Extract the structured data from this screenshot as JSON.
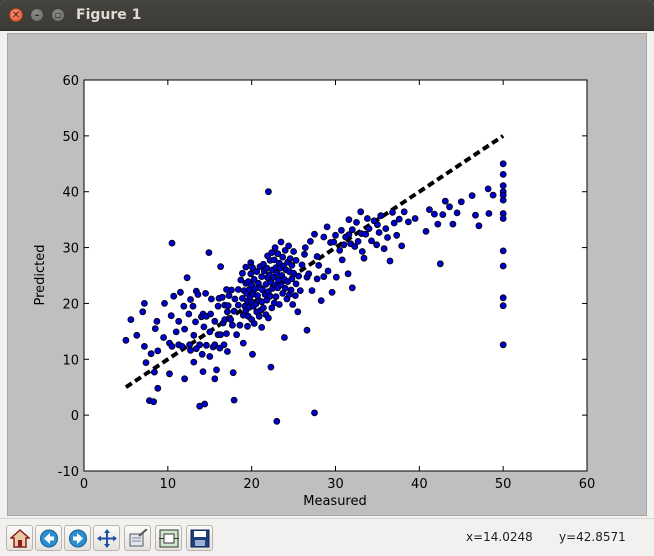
{
  "window": {
    "title": "Figure 1",
    "close_glyph": "✕",
    "minimize_glyph": "–",
    "maximize_glyph": "▫"
  },
  "toolbar": {
    "buttons": [
      {
        "name": "home-button",
        "icon": "home-icon"
      },
      {
        "name": "back-button",
        "icon": "back-arrow-icon"
      },
      {
        "name": "forward-button",
        "icon": "forward-arrow-icon"
      },
      {
        "name": "pan-button",
        "icon": "pan-icon"
      },
      {
        "name": "zoom-button",
        "icon": "zoom-rect-icon"
      },
      {
        "name": "subplots-button",
        "icon": "subplots-icon"
      },
      {
        "name": "save-button",
        "icon": "save-icon"
      }
    ],
    "coord_x": "x=14.0248",
    "coord_y": "y=42.8571"
  },
  "chart_data": {
    "type": "scatter",
    "xlabel": "Measured",
    "ylabel": "Predicted",
    "xlim": [
      0,
      60
    ],
    "ylim": [
      -10,
      60
    ],
    "xticks": [
      0,
      10,
      20,
      30,
      40,
      50,
      60
    ],
    "yticks": [
      -10,
      0,
      10,
      20,
      30,
      40,
      50,
      60
    ],
    "grid": false,
    "point_color": "#0000cc",
    "reference_line": {
      "x": [
        5,
        50
      ],
      "y": [
        5,
        50
      ],
      "style": "dashed",
      "color": "#000000"
    },
    "points": [
      [
        5,
        13.4
      ],
      [
        5.6,
        17.1
      ],
      [
        6.3,
        14.3
      ],
      [
        7,
        18.5
      ],
      [
        7.2,
        20
      ],
      [
        7.2,
        12.3
      ],
      [
        7.4,
        9.4
      ],
      [
        8,
        11
      ],
      [
        7.8,
        2.6
      ],
      [
        8.3,
        2.4
      ],
      [
        8.8,
        11.5
      ],
      [
        8.5,
        15.5
      ],
      [
        8.4,
        7.7
      ],
      [
        8.8,
        4.8
      ],
      [
        8.7,
        16.8
      ],
      [
        9.5,
        13.9
      ],
      [
        9.6,
        20
      ],
      [
        10.2,
        12.9
      ],
      [
        10.4,
        17.8
      ],
      [
        10.2,
        7.4
      ],
      [
        10.5,
        30.8
      ],
      [
        10.5,
        12.3
      ],
      [
        10.7,
        21.3
      ],
      [
        11,
        14.9
      ],
      [
        11.3,
        12.6
      ],
      [
        11.3,
        16.8
      ],
      [
        11.5,
        22
      ],
      [
        11.7,
        12.3
      ],
      [
        11.9,
        19.5
      ],
      [
        12,
        6.5
      ],
      [
        12,
        15.4
      ],
      [
        12.3,
        24.6
      ],
      [
        12.5,
        18.1
      ],
      [
        12.6,
        12.6
      ],
      [
        12.7,
        20.7
      ],
      [
        12.7,
        11.6
      ],
      [
        13,
        19.5
      ],
      [
        13.1,
        14.3
      ],
      [
        13.3,
        16.7
      ],
      [
        13.4,
        22.2
      ],
      [
        13.1,
        9.5
      ],
      [
        13.4,
        11.9
      ],
      [
        13.6,
        21.6
      ],
      [
        13.8,
        12.6
      ],
      [
        13.8,
        1.6
      ],
      [
        14,
        17.6
      ],
      [
        14.2,
        7.8
      ],
      [
        14.2,
        18.1
      ],
      [
        14.1,
        10.9
      ],
      [
        14.3,
        15.8
      ],
      [
        14.4,
        2
      ],
      [
        14.5,
        21.8
      ],
      [
        14.6,
        12.5
      ],
      [
        14.6,
        17.7
      ],
      [
        14.9,
        29.1
      ],
      [
        15,
        10.5
      ],
      [
        15,
        14.9
      ],
      [
        15.1,
        18.1
      ],
      [
        15.2,
        20.8
      ],
      [
        15.4,
        12.2
      ],
      [
        15.6,
        16.8
      ],
      [
        15.6,
        6.5
      ],
      [
        15.6,
        12.6
      ],
      [
        15.8,
        8.1
      ],
      [
        16,
        19.5
      ],
      [
        16,
        14.4
      ],
      [
        16.1,
        20.9
      ],
      [
        16.2,
        12
      ],
      [
        16.3,
        14.4
      ],
      [
        16.3,
        26.6
      ],
      [
        16.5,
        21.1
      ],
      [
        16.6,
        16.5
      ],
      [
        16.7,
        12.6
      ],
      [
        16.8,
        19.7
      ],
      [
        16.8,
        17.1
      ],
      [
        17,
        14.6
      ],
      [
        17,
        22.5
      ],
      [
        17.1,
        18.5
      ],
      [
        17.1,
        11.4
      ],
      [
        17.2,
        19.6
      ],
      [
        17.3,
        17.3
      ],
      [
        17.3,
        21.4
      ],
      [
        17.5,
        17.1
      ],
      [
        17.6,
        22.4
      ],
      [
        17.7,
        16.1
      ],
      [
        17.8,
        7.6
      ],
      [
        17.9,
        18.6
      ],
      [
        17.9,
        2.7
      ],
      [
        18,
        20.8
      ],
      [
        18.2,
        14.4
      ],
      [
        18.4,
        22.5
      ],
      [
        18.4,
        19.7
      ],
      [
        18.6,
        16.1
      ],
      [
        18.7,
        24.2
      ],
      [
        18.9,
        25.4
      ],
      [
        18.9,
        20.9
      ],
      [
        19,
        12.9
      ],
      [
        19,
        17.9
      ],
      [
        19.1,
        22.3
      ],
      [
        19.2,
        19.5
      ],
      [
        19.3,
        18.7
      ],
      [
        19.3,
        26.5
      ],
      [
        19.3,
        23.6
      ],
      [
        19.4,
        21.8
      ],
      [
        19.5,
        15.9
      ],
      [
        19.5,
        20.4
      ],
      [
        19.6,
        17.7
      ],
      [
        19.6,
        23.9
      ],
      [
        19.7,
        19.3
      ],
      [
        19.7,
        22.5
      ],
      [
        19.8,
        21.1
      ],
      [
        19.9,
        25.3
      ],
      [
        19.9,
        27.3
      ],
      [
        20,
        20.2
      ],
      [
        20,
        17.1
      ],
      [
        20,
        23.3
      ],
      [
        20.1,
        10.9
      ],
      [
        20.1,
        26.4
      ],
      [
        20.2,
        19.5
      ],
      [
        20.2,
        21.7
      ],
      [
        20.3,
        24.3
      ],
      [
        20.3,
        16.4
      ],
      [
        20.4,
        22.6
      ],
      [
        20.5,
        19.9
      ],
      [
        20.6,
        18.5
      ],
      [
        20.6,
        25.7
      ],
      [
        20.7,
        21.4
      ],
      [
        20.8,
        23.6
      ],
      [
        20.9,
        17.7
      ],
      [
        20.9,
        20.5
      ],
      [
        21,
        22.8
      ],
      [
        21,
        26.6
      ],
      [
        21.1,
        18.8
      ],
      [
        21.2,
        24.8
      ],
      [
        21.2,
        20.3
      ],
      [
        21.2,
        15.7
      ],
      [
        21.3,
        22.4
      ],
      [
        21.4,
        27
      ],
      [
        21.4,
        19.2
      ],
      [
        21.5,
        25.8
      ],
      [
        21.6,
        21.6
      ],
      [
        21.7,
        23.4
      ],
      [
        21.7,
        18
      ],
      [
        21.8,
        26.3
      ],
      [
        21.8,
        20.6
      ],
      [
        21.9,
        28.5
      ],
      [
        21.9,
        24.6
      ],
      [
        22,
        40
      ],
      [
        22,
        22.1
      ],
      [
        22,
        17.4
      ],
      [
        22.1,
        25.1
      ],
      [
        22.2,
        27.7
      ],
      [
        22.2,
        21.3
      ],
      [
        22.3,
        8.6
      ],
      [
        22.3,
        23.8
      ],
      [
        22.4,
        19.2
      ],
      [
        22.4,
        29.1
      ],
      [
        22.5,
        26
      ],
      [
        22.5,
        22.7
      ],
      [
        22.6,
        24.7
      ],
      [
        22.7,
        20.1
      ],
      [
        22.7,
        27.8
      ],
      [
        22.8,
        23.3
      ],
      [
        22.8,
        30
      ],
      [
        22.9,
        21.2
      ],
      [
        22.9,
        26.4
      ],
      [
        23,
        25.4
      ],
      [
        23,
        -1.1
      ],
      [
        23.1,
        22.8
      ],
      [
        23.1,
        28.9
      ],
      [
        23.2,
        24.2
      ],
      [
        23.3,
        27.2
      ],
      [
        23.3,
        19.8
      ],
      [
        23.4,
        26.3
      ],
      [
        23.5,
        23.3
      ],
      [
        23.5,
        31
      ],
      [
        23.6,
        25
      ],
      [
        23.7,
        21.8
      ],
      [
        23.7,
        28.3
      ],
      [
        23.8,
        26.7
      ],
      [
        23.9,
        24.3
      ],
      [
        23.9,
        13.9
      ],
      [
        24,
        22.7
      ],
      [
        24,
        29.5
      ],
      [
        24.1,
        26
      ],
      [
        24.2,
        20.8
      ],
      [
        24.3,
        27.4
      ],
      [
        24.3,
        23.9
      ],
      [
        24.4,
        30.3
      ],
      [
        24.5,
        21.6
      ],
      [
        24.5,
        25.7
      ],
      [
        24.6,
        28
      ],
      [
        24.7,
        22.4
      ],
      [
        24.8,
        24.4
      ],
      [
        24.8,
        26.8
      ],
      [
        24.9,
        19.8
      ],
      [
        25,
        25.4
      ],
      [
        25,
        29.3
      ],
      [
        25.2,
        21.4
      ],
      [
        25.3,
        27.7
      ],
      [
        25.3,
        23.5
      ],
      [
        25.5,
        18.5
      ],
      [
        25.6,
        24.9
      ],
      [
        25.8,
        22.3
      ],
      [
        26,
        26.9
      ],
      [
        26.3,
        28.8
      ],
      [
        26.4,
        30
      ],
      [
        26.6,
        15.2
      ],
      [
        26.6,
        24.7
      ],
      [
        26.8,
        25.3
      ],
      [
        27,
        31.1
      ],
      [
        27.2,
        22.3
      ],
      [
        27.5,
        0.4
      ],
      [
        27.5,
        32.4
      ],
      [
        27.8,
        28.4
      ],
      [
        27.8,
        24.4
      ],
      [
        28,
        26.8
      ],
      [
        28.3,
        20.5
      ],
      [
        28.6,
        31.9
      ],
      [
        28.6,
        24.8
      ],
      [
        29,
        33.7
      ],
      [
        29.1,
        25.8
      ],
      [
        29.4,
        30.9
      ],
      [
        29.6,
        22
      ],
      [
        29.8,
        31
      ],
      [
        30,
        32.2
      ],
      [
        30.1,
        24.7
      ],
      [
        30.5,
        29.5
      ],
      [
        30.7,
        33.1
      ],
      [
        30.8,
        27.8
      ],
      [
        31,
        30.5
      ],
      [
        31.2,
        31.9
      ],
      [
        31.5,
        25.3
      ],
      [
        31.6,
        32.3
      ],
      [
        31.6,
        35
      ],
      [
        31.8,
        30.7
      ],
      [
        32,
        33.2
      ],
      [
        32,
        22.8
      ],
      [
        32.3,
        30.2
      ],
      [
        32.5,
        34.5
      ],
      [
        32.7,
        31.1
      ],
      [
        33,
        36.4
      ],
      [
        33.1,
        32.5
      ],
      [
        33.2,
        29.3
      ],
      [
        33.4,
        28.1
      ],
      [
        33.6,
        32.4
      ],
      [
        33.8,
        35.2
      ],
      [
        34,
        33.4
      ],
      [
        34.3,
        31.2
      ],
      [
        34.6,
        34.8
      ],
      [
        34.9,
        30.5
      ],
      [
        35,
        34.1
      ],
      [
        35.2,
        32.7
      ],
      [
        35.4,
        35.7
      ],
      [
        35.8,
        29.8
      ],
      [
        36,
        33.4
      ],
      [
        36.2,
        31.8
      ],
      [
        36.5,
        27.6
      ],
      [
        36.8,
        36.3
      ],
      [
        37,
        34.4
      ],
      [
        37.3,
        32.2
      ],
      [
        37.6,
        35.1
      ],
      [
        37.9,
        30.3
      ],
      [
        38.2,
        36.4
      ],
      [
        38.7,
        34.6
      ],
      [
        39.5,
        35.2
      ],
      [
        40.8,
        32.9
      ],
      [
        41.2,
        36.8
      ],
      [
        41.8,
        36
      ],
      [
        42.2,
        34.2
      ],
      [
        42.5,
        27.1
      ],
      [
        42.8,
        35.9
      ],
      [
        43.1,
        38.3
      ],
      [
        43.6,
        37.3
      ],
      [
        44,
        34.2
      ],
      [
        44.5,
        36.2
      ],
      [
        45,
        38.2
      ],
      [
        46.3,
        39.3
      ],
      [
        46.7,
        35.8
      ],
      [
        47.1,
        33.9
      ],
      [
        48.2,
        40.5
      ],
      [
        48.3,
        36.1
      ],
      [
        48.8,
        39.4
      ],
      [
        50,
        45
      ],
      [
        50,
        43.1
      ],
      [
        50,
        41.1
      ],
      [
        50,
        40
      ],
      [
        50,
        39.4
      ],
      [
        50,
        38.5
      ],
      [
        50,
        36.1
      ],
      [
        50,
        35.2
      ],
      [
        50,
        29.4
      ],
      [
        50,
        26.7
      ],
      [
        50,
        21
      ],
      [
        50,
        19.6
      ],
      [
        50,
        12.6
      ]
    ]
  }
}
